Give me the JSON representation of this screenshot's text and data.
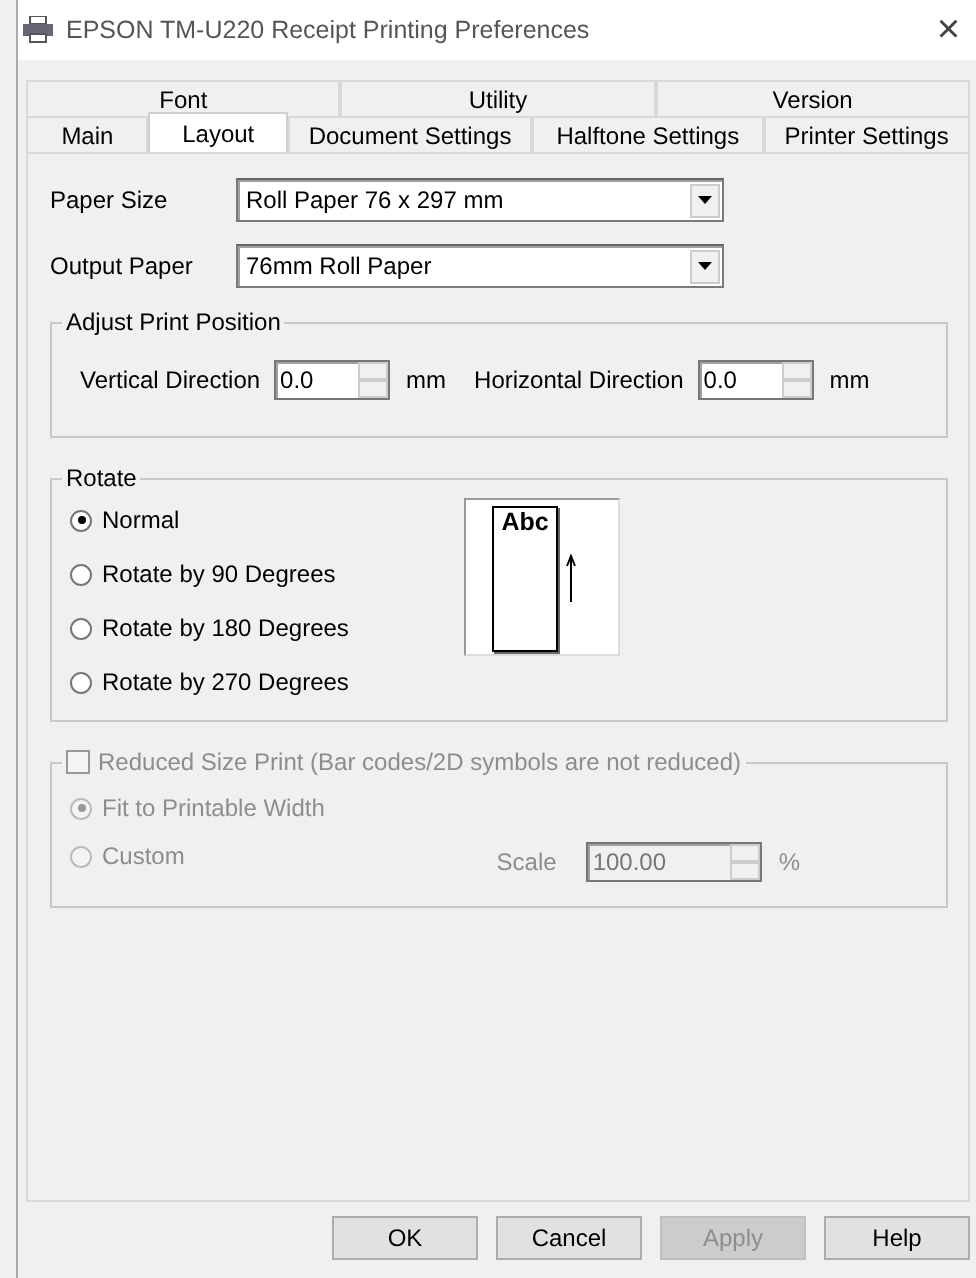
{
  "window": {
    "title": "EPSON TM-U220 Receipt Printing Preferences",
    "close": "×"
  },
  "tabs": [
    [
      {
        "label": "Font",
        "selected": false
      },
      {
        "label": "Utility",
        "selected": false
      },
      {
        "label": "Version",
        "selected": false
      }
    ],
    [
      {
        "label": "Main",
        "selected": false
      },
      {
        "label": "Layout",
        "selected": true
      },
      {
        "label": "Document Settings",
        "selected": false
      },
      {
        "label": "Halftone Settings",
        "selected": false
      },
      {
        "label": "Printer Settings",
        "selected": false
      }
    ]
  ],
  "selects": [
    {
      "label": "Paper Size",
      "value": "Roll Paper 76 x 297 mm"
    },
    {
      "label": "Output Paper",
      "value": "76mm Roll Paper"
    }
  ],
  "adjust_print_position": {
    "title": "Adjust Print Position",
    "fields": [
      {
        "label": "Vertical Direction",
        "value": "0.0",
        "unit": "mm"
      },
      {
        "label": "Horizontal Direction",
        "value": "0.0",
        "unit": "mm"
      }
    ]
  },
  "rotate": {
    "title": "Rotate",
    "options": [
      {
        "label": "Normal",
        "selected": true
      },
      {
        "label": "Rotate by 90 Degrees",
        "selected": false
      },
      {
        "label": "Rotate by 180 Degrees",
        "selected": false
      },
      {
        "label": "Rotate by 270 Degrees",
        "selected": false
      }
    ],
    "preview_text": "Abc"
  },
  "reduced_size_print": {
    "label": "Reduced Size Print (Bar codes/2D symbols are not reduced)",
    "checked": false,
    "disabled": true,
    "options": [
      {
        "label": "Fit to Printable Width",
        "selected": true
      },
      {
        "label": "Custom",
        "selected": false
      }
    ],
    "scale": {
      "label": "Scale",
      "value": "100.00",
      "unit": "%"
    }
  },
  "buttons": [
    {
      "label": "OK",
      "disabled": false
    },
    {
      "label": "Cancel",
      "disabled": false
    },
    {
      "label": "Apply",
      "disabled": true
    },
    {
      "label": "Help",
      "disabled": false
    }
  ]
}
